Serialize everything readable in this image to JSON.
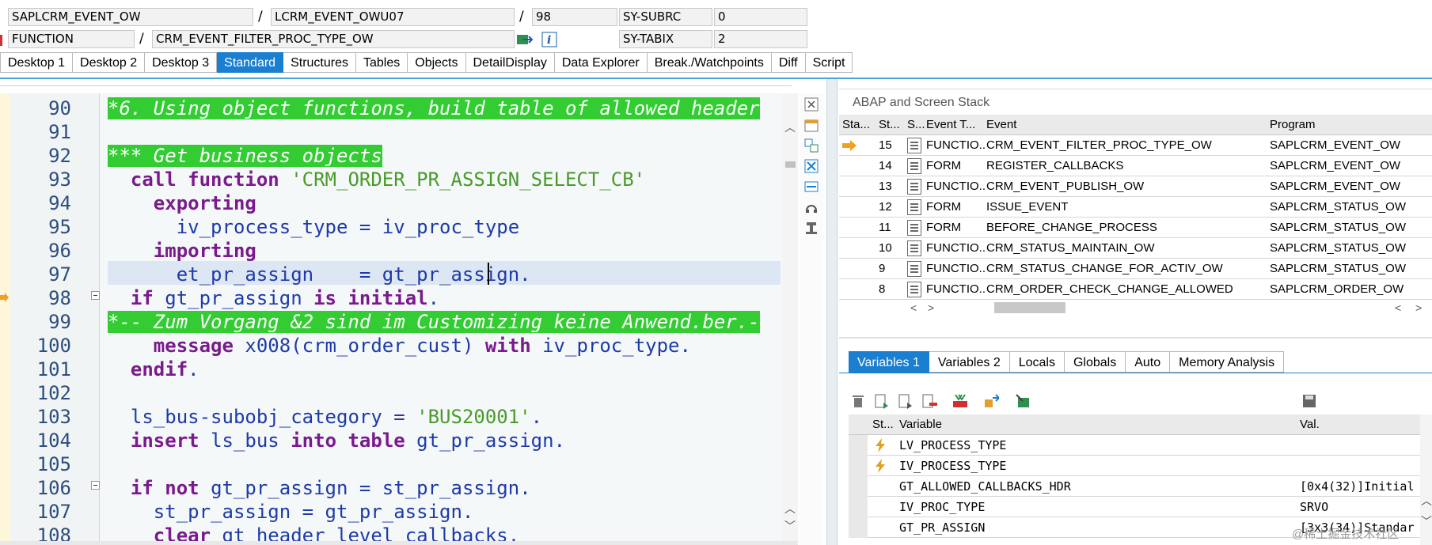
{
  "header": {
    "program": "SAPLCRM_EVENT_OW",
    "include": "LCRM_EVENT_OWU07",
    "line": "98",
    "type": "FUNCTION",
    "name": "CRM_EVENT_FILTER_PROC_TYPE_OW",
    "sep1": "/",
    "sep2": "/",
    "sep3": "/",
    "sysvars": [
      {
        "name": "SY-SUBRC",
        "value": "0"
      },
      {
        "name": "SY-TABIX",
        "value": "2"
      }
    ]
  },
  "tabs": [
    "Desktop 1",
    "Desktop 2",
    "Desktop 3",
    "Standard",
    "Structures",
    "Tables",
    "Objects",
    "DetailDisplay",
    "Data Explorer",
    "Break./Watchpoints",
    "Diff",
    "Script"
  ],
  "active_tab": "Standard",
  "code": {
    "lines": [
      {
        "n": "90",
        "t": "*6. Using object functions, build table of allowed header"
      },
      {
        "n": "91",
        "t": ""
      },
      {
        "n": "92",
        "t": "*** Get business objects"
      },
      {
        "n": "93a",
        "t": "  call function"
      },
      {
        "n": "93b",
        "t": "'CRM_ORDER_PR_ASSIGN_SELECT_CB'"
      },
      {
        "n": "94",
        "t": "exporting"
      },
      {
        "n": "95",
        "t": "iv_process_type = iv_proc_type"
      },
      {
        "n": "96",
        "t": "importing"
      },
      {
        "n": "97",
        "t": "et_pr_assign    = gt_pr_assign."
      },
      {
        "n": "98a",
        "t": "if"
      },
      {
        "n": "98b",
        "t": "gt_pr_assign"
      },
      {
        "n": "98c",
        "t": "is initial"
      },
      {
        "n": "99",
        "t": "*-- Zum Vorgang &2 sind im Customizing keine Anwend.ber.-"
      },
      {
        "n": "100a",
        "t": "message"
      },
      {
        "n": "100b",
        "t": "x008(crm_order_cust)"
      },
      {
        "n": "100c",
        "t": "with"
      },
      {
        "n": "100d",
        "t": "iv_proc_type."
      },
      {
        "n": "101",
        "t": "endif"
      },
      {
        "n": "103a",
        "t": "ls_bus-subobj_category = "
      },
      {
        "n": "103b",
        "t": "'BUS20001'"
      },
      {
        "n": "104a",
        "t": "insert"
      },
      {
        "n": "104b",
        "t": "ls_bus"
      },
      {
        "n": "104c",
        "t": "into table"
      },
      {
        "n": "104d",
        "t": "gt_pr_assign."
      },
      {
        "n": "106a",
        "t": "if not"
      },
      {
        "n": "106b",
        "t": "gt_pr_assign = st_pr_assign."
      },
      {
        "n": "107",
        "t": "st_pr_assign = gt_pr_assign."
      },
      {
        "n": "108a",
        "t": "clear"
      },
      {
        "n": "108b",
        "t": "gt_header_level_callbacks."
      }
    ],
    "numbers": [
      "90",
      "91",
      "92",
      "93",
      "94",
      "95",
      "96",
      "97",
      "98",
      "99",
      "100",
      "101",
      "102",
      "103",
      "104",
      "105",
      "106",
      "107",
      "108"
    ]
  },
  "stack": {
    "title": "ABAP and Screen Stack",
    "headers": [
      "Sta...",
      "St...",
      "S...",
      "Event T...",
      "Event",
      "Program"
    ],
    "rows": [
      {
        "level": "15",
        "type": "FUNCTIO...",
        "event": "CRM_EVENT_FILTER_PROC_TYPE_OW",
        "program": "SAPLCRM_EVENT_OW",
        "current": true
      },
      {
        "level": "14",
        "type": "FORM",
        "event": "REGISTER_CALLBACKS",
        "program": "SAPLCRM_EVENT_OW"
      },
      {
        "level": "13",
        "type": "FUNCTIO...",
        "event": "CRM_EVENT_PUBLISH_OW",
        "program": "SAPLCRM_EVENT_OW"
      },
      {
        "level": "12",
        "type": "FORM",
        "event": "ISSUE_EVENT",
        "program": "SAPLCRM_STATUS_OW"
      },
      {
        "level": "11",
        "type": "FORM",
        "event": "BEFORE_CHANGE_PROCESS",
        "program": "SAPLCRM_STATUS_OW"
      },
      {
        "level": "10",
        "type": "FUNCTIO...",
        "event": "CRM_STATUS_MAINTAIN_OW",
        "program": "SAPLCRM_STATUS_OW"
      },
      {
        "level": "9",
        "type": "FUNCTIO...",
        "event": "CRM_STATUS_CHANGE_FOR_ACTIV_OW",
        "program": "SAPLCRM_STATUS_OW"
      },
      {
        "level": "8",
        "type": "FUNCTIO...",
        "event": "CRM_ORDER_CHECK_CHANGE_ALLOWED",
        "program": "SAPLCRM_ORDER_OW"
      }
    ]
  },
  "variables": {
    "tabs": [
      "Variables 1",
      "Variables 2",
      "Locals",
      "Globals",
      "Auto",
      "Memory Analysis"
    ],
    "active_tab": "Variables 1",
    "headers": [
      "St...",
      "Variable",
      "Val."
    ],
    "rows": [
      {
        "name": "LV_PROCESS_TYPE",
        "value": "",
        "flash": true
      },
      {
        "name": "IV_PROCESS_TYPE",
        "value": "",
        "flash": true
      },
      {
        "name": "GT_ALLOWED_CALLBACKS_HDR",
        "value": "[0x4(32)]Initial"
      },
      {
        "name": "IV_PROC_TYPE",
        "value": "SRVO"
      },
      {
        "name": "GT_PR_ASSIGN",
        "value": "[3x3(34)]Standar"
      }
    ]
  },
  "watermark": "@稀土掘金技术社区",
  "colors": {
    "accent": "#1a7fd0",
    "comment_bg": "#33cc33",
    "keyword": "#7a1a8c",
    "string": "#4a9a2a"
  }
}
